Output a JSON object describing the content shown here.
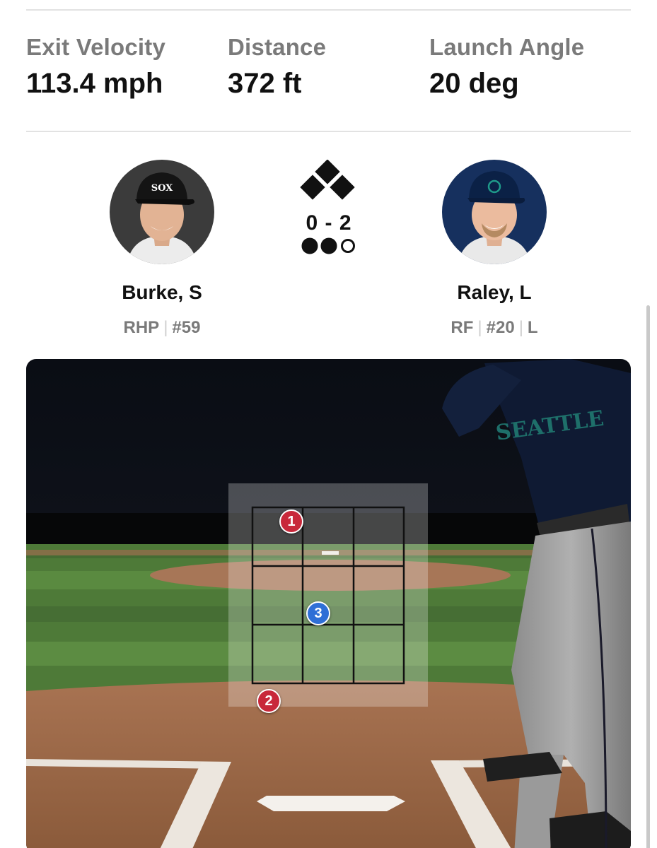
{
  "stats": [
    {
      "label": "Exit Velocity",
      "value": "113.4 mph"
    },
    {
      "label": "Distance",
      "value": "372 ft"
    },
    {
      "label": "Launch Angle",
      "value": "20 deg"
    }
  ],
  "pitcher": {
    "name": "Burke, S",
    "position": "RHP",
    "number": "#59",
    "cap_logo": "SOX"
  },
  "batter": {
    "name": "Raley, L",
    "position": "RF",
    "number": "#20",
    "bats": "L",
    "jersey_text": "SEATTLE"
  },
  "situation": {
    "count": "0 - 2",
    "bases": {
      "first": true,
      "second": true,
      "third": true
    },
    "outs": {
      "filled": 2,
      "total": 3
    }
  },
  "pitches": [
    {
      "label": "1",
      "result": "ball",
      "color": "#c8283a"
    },
    {
      "label": "2",
      "result": "ball",
      "color": "#c8283a"
    },
    {
      "label": "3",
      "result": "in-play",
      "color": "#2f6fd6"
    }
  ],
  "colors": {
    "stat_label": "#7a7a7a",
    "ball": "#c8283a",
    "in_play": "#2f6fd6",
    "sky": "#0e1118",
    "grass": "#4e7a38",
    "dirt": "#9a6a48"
  }
}
